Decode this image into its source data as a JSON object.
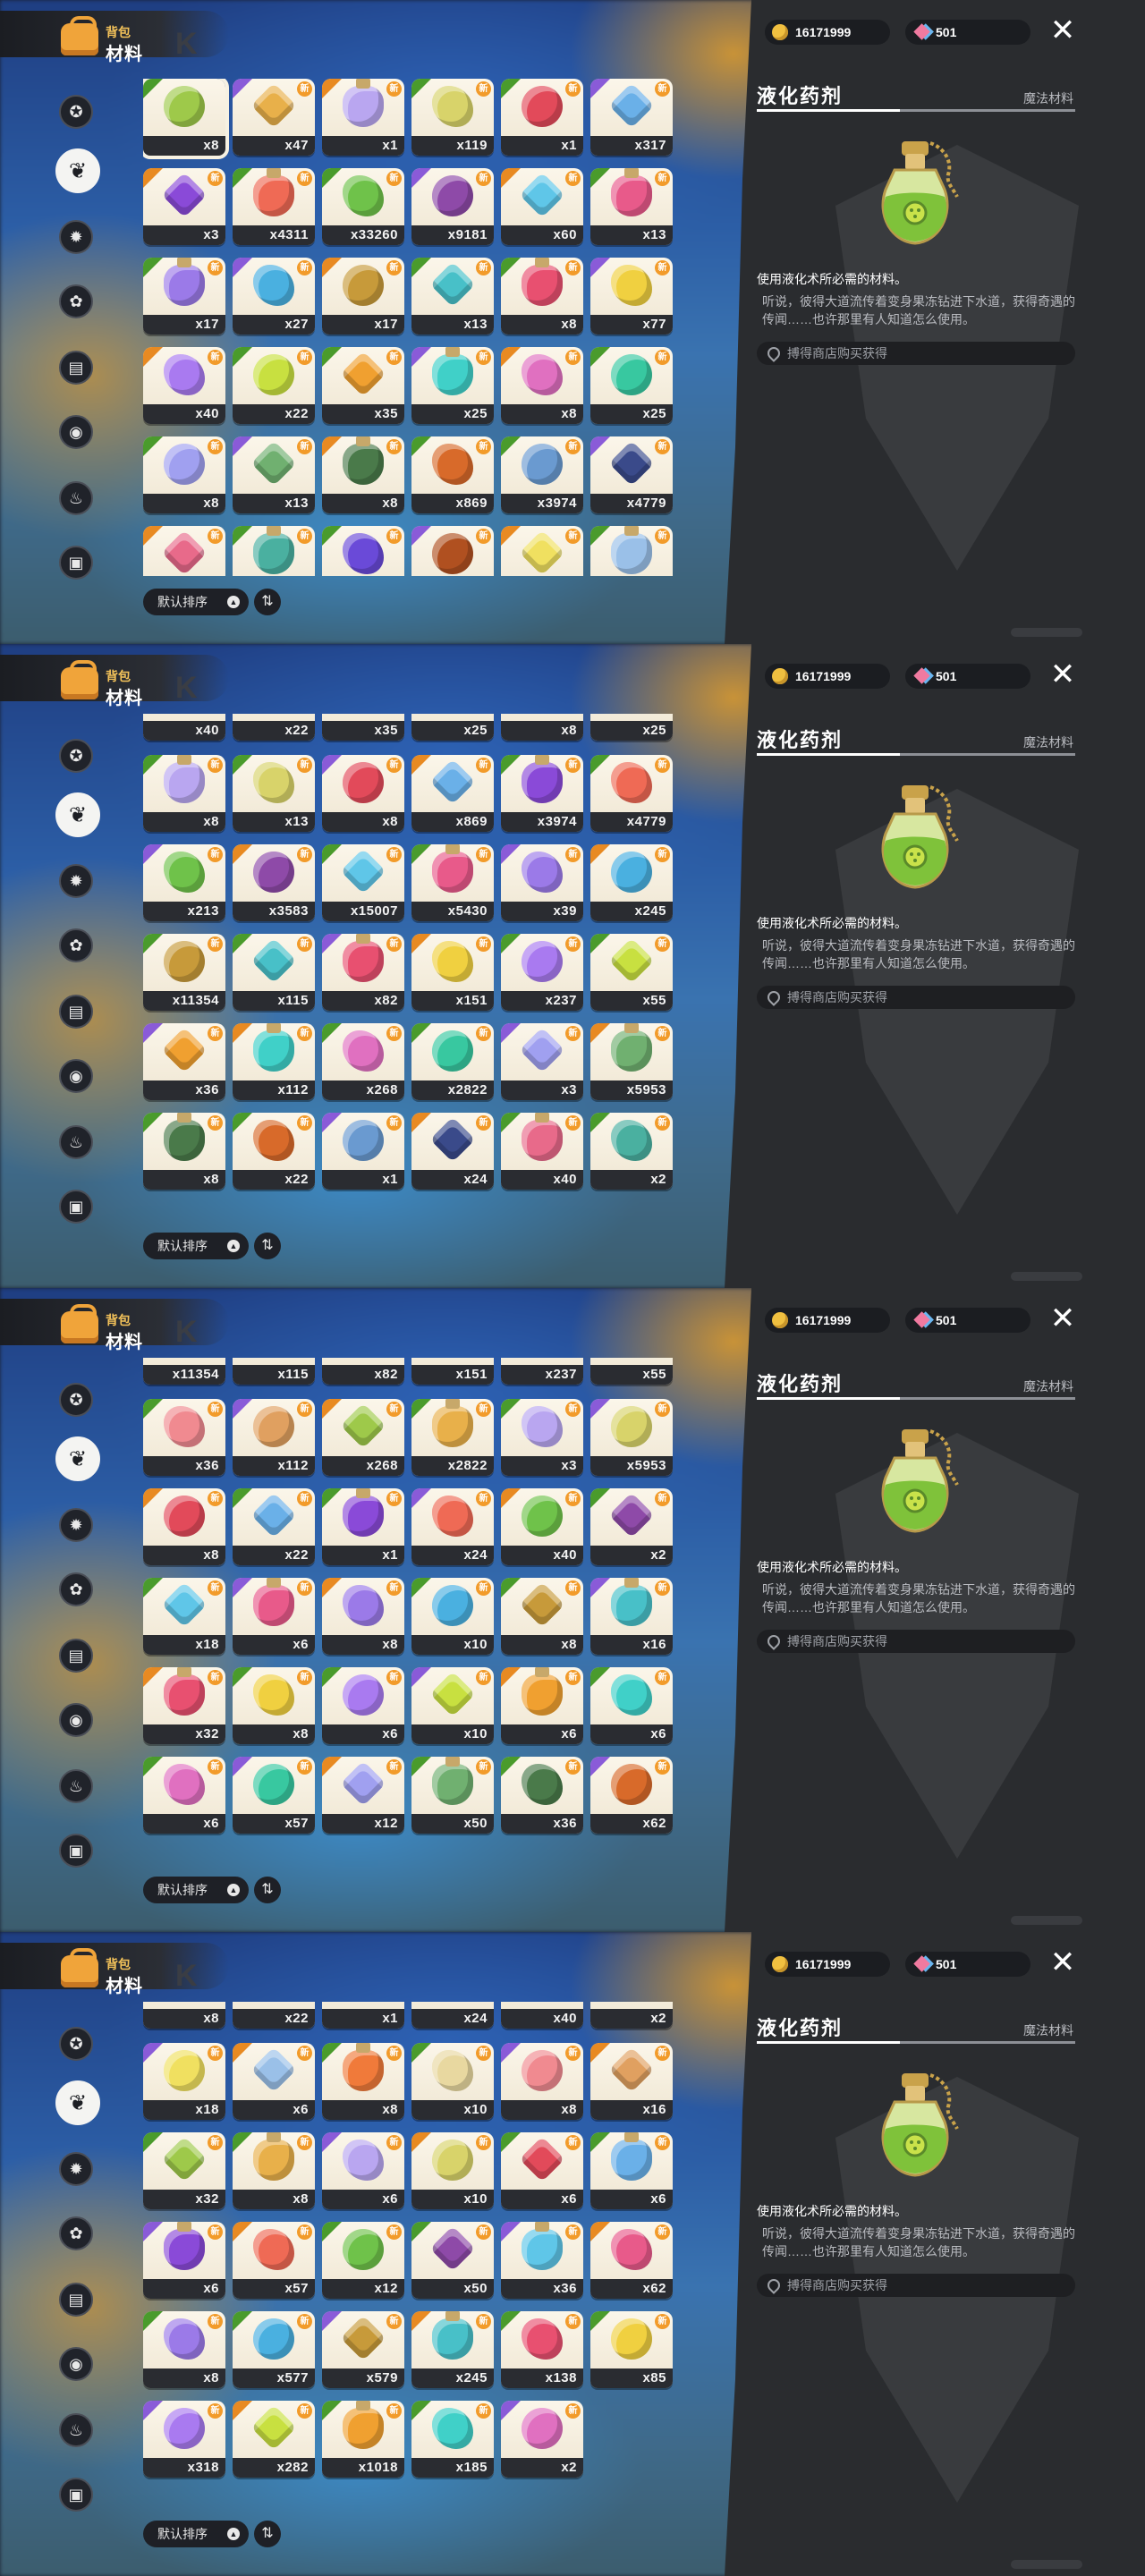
{
  "header": {
    "title_small": "背包",
    "title_big": "材料"
  },
  "currency": {
    "coins": "16171999",
    "gems": "501"
  },
  "sort": {
    "label": "默认排序"
  },
  "nav_icons": [
    "compass-icon",
    "leaf-icon",
    "badge-icon",
    "flower-icon",
    "scroll-icon",
    "orb-icon",
    "bell-icon",
    "chest-icon"
  ],
  "detail": {
    "name": "液化药剂",
    "category": "魔法材料",
    "description": "使用液化术所必需的材料。",
    "lore": "听说，彼得大道流传着变身果冻钻进下水道，获得奇遇的传闻……也许那里有人知道怎么使用。",
    "source": "搏得商店购买获得"
  },
  "colors": {
    "accent_new": "#f29b2a",
    "rarity_green": "#4a9b2c",
    "rarity_purple": "#8a5bd8",
    "panel": "#2a2c2f"
  },
  "panels": [
    {
      "rows": [
        [
          "x8",
          "x47",
          "x1",
          "x119",
          "x1",
          "x317"
        ],
        [
          "x3",
          "x4311",
          "x33260",
          "x9181",
          "x60",
          "x13"
        ],
        [
          "x17",
          "x27",
          "x17",
          "x13",
          "x8",
          "x77"
        ],
        [
          "x40",
          "x22",
          "x35",
          "x25",
          "x8",
          "x25"
        ],
        [
          "x8",
          "x13",
          "x8",
          "x869",
          "x3974",
          "x4779"
        ],
        [
          "",
          "",
          "",
          "",
          "",
          ""
        ]
      ]
    },
    {
      "rows": [
        [
          "x40",
          "x22",
          "x35",
          "x25",
          "x8",
          "x25"
        ],
        [
          "x8",
          "x13",
          "x8",
          "x869",
          "x3974",
          "x4779"
        ],
        [
          "x213",
          "x3583",
          "x15007",
          "x5430",
          "x39",
          "x245"
        ],
        [
          "x11354",
          "x115",
          "x82",
          "x151",
          "x237",
          "x55"
        ],
        [
          "x36",
          "x112",
          "x268",
          "x2822",
          "x3",
          "x5953"
        ],
        [
          "x8",
          "x22",
          "x1",
          "x24",
          "x40",
          "x2"
        ]
      ]
    },
    {
      "rows": [
        [
          "x11354",
          "x115",
          "x82",
          "x151",
          "x237",
          "x55"
        ],
        [
          "x36",
          "x112",
          "x268",
          "x2822",
          "x3",
          "x5953"
        ],
        [
          "x8",
          "x22",
          "x1",
          "x24",
          "x40",
          "x2"
        ],
        [
          "x18",
          "x6",
          "x8",
          "x10",
          "x8",
          "x16"
        ],
        [
          "x32",
          "x8",
          "x6",
          "x10",
          "x6",
          "x6"
        ],
        [
          "x6",
          "x57",
          "x12",
          "x50",
          "x36",
          "x62"
        ]
      ]
    },
    {
      "rows": [
        [
          "x8",
          "x22",
          "x1",
          "x24",
          "x40",
          "x2"
        ],
        [
          "x18",
          "x6",
          "x8",
          "x10",
          "x8",
          "x16"
        ],
        [
          "x32",
          "x8",
          "x6",
          "x10",
          "x6",
          "x6"
        ],
        [
          "x6",
          "x57",
          "x12",
          "x50",
          "x36",
          "x62"
        ],
        [
          "x8",
          "x577",
          "x579",
          "x245",
          "x138",
          "x85"
        ],
        [
          "x318",
          "x282",
          "x1018",
          "x185",
          "x2"
        ]
      ]
    }
  ]
}
